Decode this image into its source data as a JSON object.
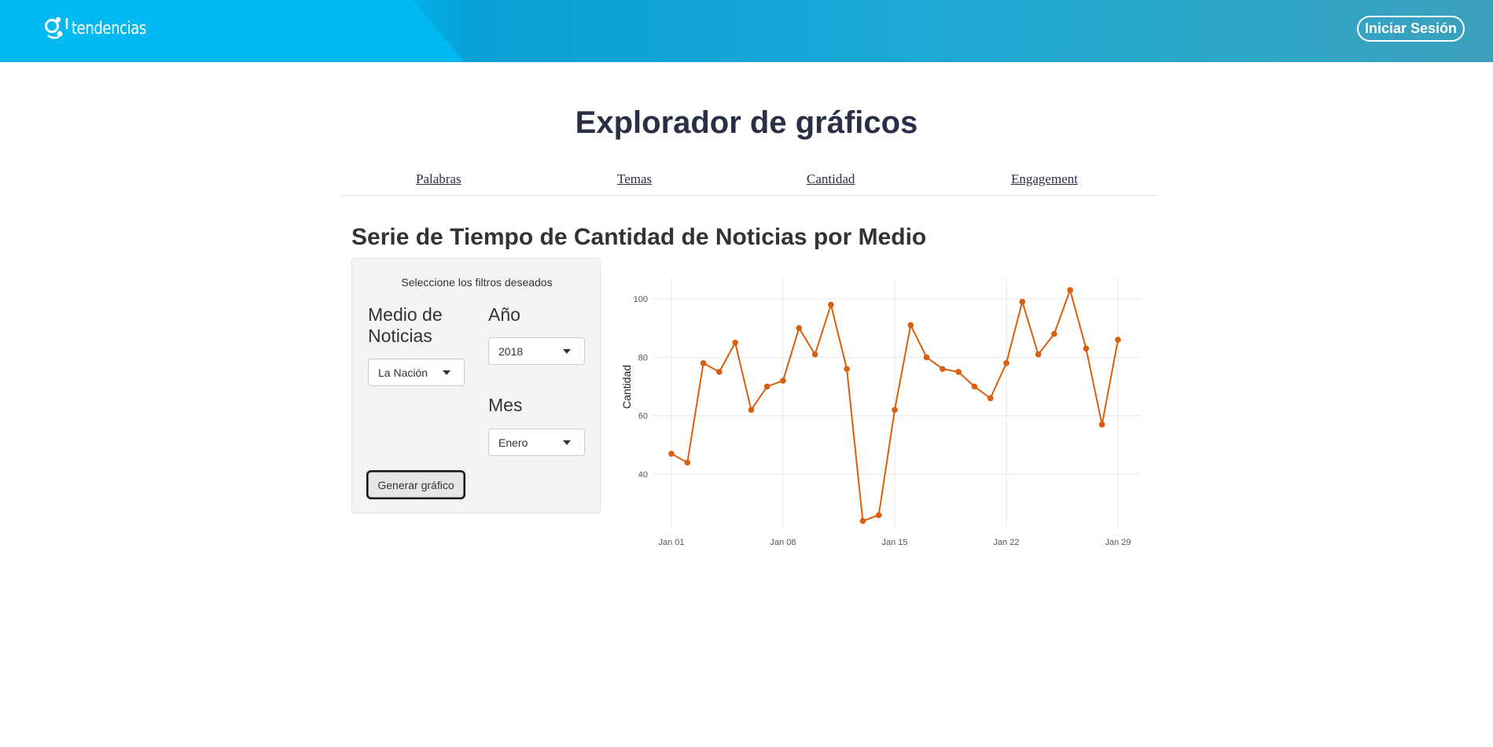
{
  "header": {
    "logo_text": "tendencias",
    "login_label": "Iniciar Sesión",
    "colors": {
      "brand": "#00b9f1",
      "accent": "#0a9fd6"
    }
  },
  "page": {
    "title": "Explorador de gráficos"
  },
  "tabs": [
    {
      "label": "Palabras"
    },
    {
      "label": "Temas"
    },
    {
      "label": "Cantidad"
    },
    {
      "label": "Engagement"
    }
  ],
  "section": {
    "title": "Serie de Tiempo de Cantidad de Noticias por Medio"
  },
  "filters": {
    "caption": "Seleccione los filtros deseados",
    "medio_label": "Medio de Noticias",
    "medio_value": "La Nación",
    "anio_label": "Año",
    "anio_value": "2018",
    "mes_label": "Mes",
    "mes_value": "Enero",
    "generate_label": "Generar gráfico"
  },
  "chart_data": {
    "type": "line",
    "title": "",
    "xlabel": "",
    "ylabel": "Cantidad",
    "x": [
      "2018-01-01",
      "2018-01-02",
      "2018-01-03",
      "2018-01-04",
      "2018-01-05",
      "2018-01-06",
      "2018-01-07",
      "2018-01-08",
      "2018-01-09",
      "2018-01-10",
      "2018-01-11",
      "2018-01-12",
      "2018-01-13",
      "2018-01-14",
      "2018-01-15",
      "2018-01-16",
      "2018-01-17",
      "2018-01-18",
      "2018-01-19",
      "2018-01-20",
      "2018-01-21",
      "2018-01-22",
      "2018-01-23",
      "2018-01-24",
      "2018-01-25",
      "2018-01-26",
      "2018-01-27",
      "2018-01-28",
      "2018-01-29"
    ],
    "series": [
      {
        "values": [
          47,
          44,
          78,
          75,
          85,
          62,
          70,
          72,
          90,
          81,
          98,
          76,
          24,
          26,
          62,
          91,
          80,
          76,
          75,
          70,
          66,
          78,
          99,
          81,
          88,
          103,
          83,
          57,
          86
        ],
        "color": "#d95f0e"
      }
    ],
    "x_ticks": [
      "Jan 01",
      "Jan 08",
      "Jan 15",
      "Jan 22",
      "Jan 29"
    ],
    "y_ticks": [
      40,
      60,
      80,
      100
    ],
    "ylim": [
      22,
      107
    ],
    "grid": true
  }
}
